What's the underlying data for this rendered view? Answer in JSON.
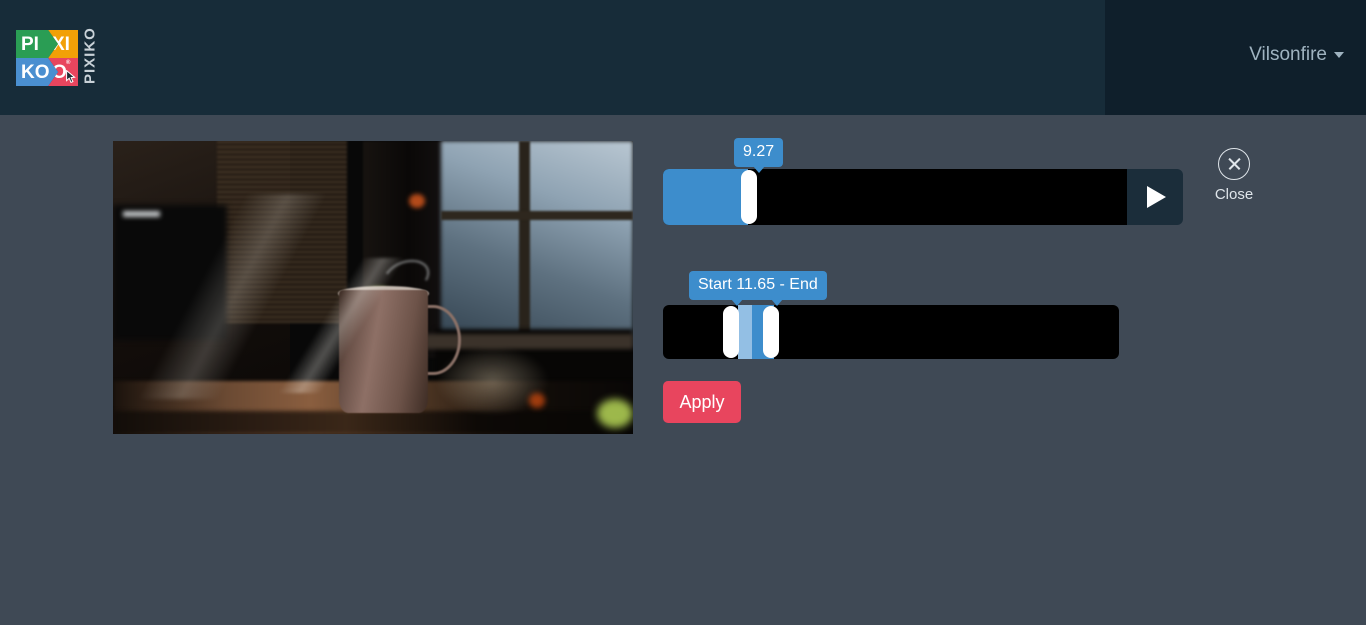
{
  "header": {
    "logo": {
      "cell_pi": "PI",
      "cell_xi": "XI",
      "cell_ko": "KO",
      "cell_o": "O",
      "registered_mark": "®",
      "wordmark": "PIXIKO"
    },
    "user_menu": {
      "username": "Vilsonfire"
    },
    "colors": {
      "band_left": "#172c39",
      "band_right": "#0f1f2b"
    }
  },
  "main": {
    "preview": {
      "alt": "video-preview-frame-coffee-mug-on-table-by-window"
    },
    "progress_slider": {
      "tooltip_value": "9.27",
      "fill_percent": 18,
      "accent_color": "#3d8dcc"
    },
    "play_button": {
      "label": "play"
    },
    "trim_slider": {
      "tooltip_text": "Start  11.65 - End",
      "start_label": "Start",
      "value": "11.65",
      "end_label": "End",
      "accent_color": "#3d8dcc",
      "accent_light": "#93bfe4"
    },
    "apply_button": {
      "label": "Apply",
      "color": "#e8455e"
    },
    "close_button": {
      "label": "Close"
    }
  },
  "page": {
    "background_color": "#3f4955"
  }
}
